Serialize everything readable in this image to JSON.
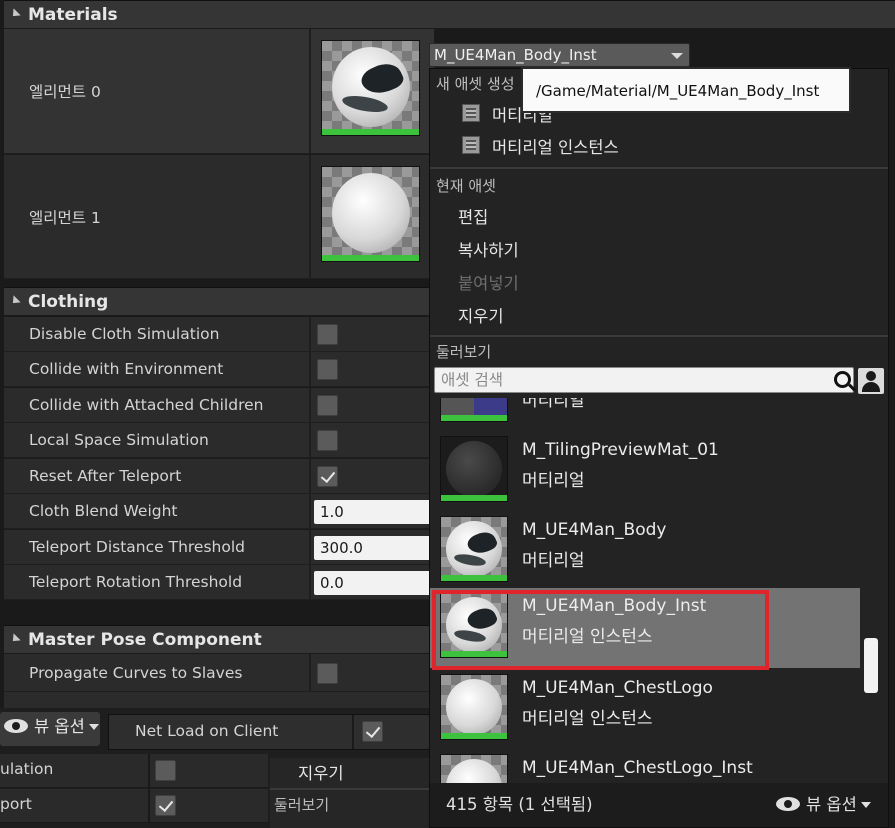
{
  "materials": {
    "header": "Materials",
    "elements": [
      {
        "label": "엘리먼트 0"
      },
      {
        "label": "엘리먼트 1"
      }
    ],
    "combo_value": "M_UE4Man_Body_Inst"
  },
  "clothing": {
    "header": "Clothing",
    "rows": [
      {
        "label": "Disable Cloth Simulation",
        "checked": false
      },
      {
        "label": "Collide with Environment",
        "checked": false
      },
      {
        "label": "Collide with Attached Children",
        "checked": false
      },
      {
        "label": "Local Space Simulation",
        "checked": false
      },
      {
        "label": "Reset After Teleport",
        "checked": true
      },
      {
        "label": "Cloth Blend Weight",
        "value": "1.0"
      },
      {
        "label": "Teleport Distance Threshold",
        "value": "300.0"
      },
      {
        "label": "Teleport Rotation Threshold",
        "value": "0.0"
      }
    ]
  },
  "master_pose": {
    "header": "Master Pose Component",
    "rows": [
      {
        "label": "Propagate Curves to Slaves",
        "checked": false
      }
    ]
  },
  "bottom": {
    "view_options": "뷰 옵션",
    "net_load_label": "Net Load on Client",
    "net_load_checked": true,
    "rows": [
      {
        "label": "ulation",
        "checked": false
      },
      {
        "label": "port",
        "checked": true
      }
    ],
    "under_menu_clear": "지우기",
    "under_menu_browse": "둘러보기"
  },
  "menu": {
    "tooltip": "/Game/Material/M_UE4Man_Body_Inst",
    "new_asset_title": "새 애셋 생성",
    "new_asset_items": [
      "머티리얼",
      "머티리얼 인스턴스"
    ],
    "current_asset_title": "현재 애셋",
    "current_asset_items": [
      {
        "label": "편집",
        "enabled": true
      },
      {
        "label": "복사하기",
        "enabled": true
      },
      {
        "label": "붙여넣기",
        "enabled": false
      },
      {
        "label": "지우기",
        "enabled": true
      }
    ],
    "browse_title": "둘러보기",
    "search_placeholder": "애셋 검색",
    "assets": [
      {
        "name": "",
        "type": "머티리얼"
      },
      {
        "name": "M_TilingPreviewMat_01",
        "type": "머티리얼"
      },
      {
        "name": "M_UE4Man_Body",
        "type": "머티리얼"
      },
      {
        "name": "M_UE4Man_Body_Inst",
        "type": "머티리얼 인스턴스",
        "selected": true
      },
      {
        "name": "M_UE4Man_ChestLogo",
        "type": "머티리얼 인스턴스"
      },
      {
        "name": "M_UE4Man_ChestLogo_Inst",
        "type": ""
      }
    ],
    "count_label": "415 항목 (1 선택됨)",
    "view_options": "뷰 옵션"
  },
  "colors": {
    "highlight": "#e0242b",
    "thumb_bar": "#3cc23c",
    "selected_row": "#737373"
  }
}
